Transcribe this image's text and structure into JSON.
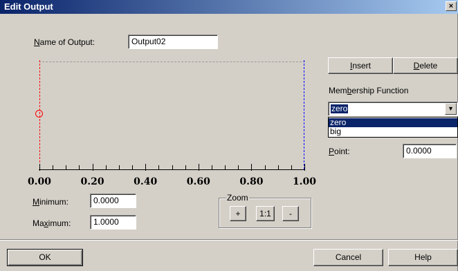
{
  "window": {
    "title": "Edit Output",
    "close_label": "×"
  },
  "name_of_output": {
    "label_pre": "",
    "label_u": "N",
    "label_post": "ame of Output:",
    "value": "Output02"
  },
  "buttons": {
    "insert": {
      "u": "I",
      "rest": "nsert"
    },
    "delete": {
      "u": "D",
      "rest": "elete"
    },
    "ok": "OK",
    "cancel": "Cancel",
    "help": "Help"
  },
  "membership": {
    "label_pre": "Mem",
    "label_u": "b",
    "label_post": "ership Function",
    "selected": "zero",
    "options": [
      "zero",
      "big"
    ]
  },
  "point": {
    "label_u": "P",
    "label_post": "oint:",
    "value": "0.0000"
  },
  "chart_data": {
    "type": "line",
    "x_tick_labels": [
      "0.00",
      "0.20",
      "0.40",
      "0.60",
      "0.80",
      "1.00"
    ],
    "xlim": [
      0,
      1
    ],
    "series": [
      {
        "color": "#ff0000",
        "x": [
          0,
          0
        ],
        "y": [
          0,
          1
        ]
      },
      {
        "color": "#0000ff",
        "x": [
          1,
          1
        ],
        "y": [
          0,
          1
        ]
      }
    ],
    "selected_point": {
      "x": 0,
      "y": 0.5
    }
  },
  "minimum": {
    "label_u": "M",
    "label_post": "inimum:",
    "value": "0.0000"
  },
  "maximum": {
    "label_pre": "Ma",
    "label_u": "x",
    "label_post": "imum:",
    "value": "1.0000"
  },
  "zoom": {
    "label": "Zoom",
    "in": "+",
    "reset": "1:1",
    "out": "-"
  }
}
